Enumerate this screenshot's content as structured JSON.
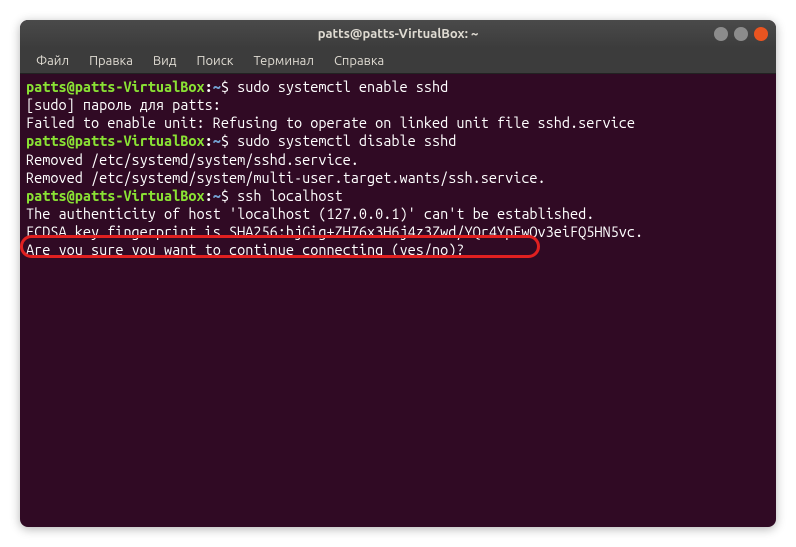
{
  "window": {
    "title": "patts@patts-VirtualBox: ~"
  },
  "menubar": {
    "items": [
      "Файл",
      "Правка",
      "Вид",
      "Поиск",
      "Терминал",
      "Справка"
    ]
  },
  "prompt": {
    "userhost": "patts@patts-VirtualBox",
    "colon": ":",
    "path": "~",
    "dollar": "$"
  },
  "lines": {
    "cmd1": " sudo systemctl enable sshd",
    "out1": "[sudo] пароль для patts:",
    "out2": "Failed to enable unit: Refusing to operate on linked unit file sshd.service",
    "cmd2": " sudo systemctl disable sshd",
    "out3": "Removed /etc/systemd/system/sshd.service.",
    "out4": "Removed /etc/systemd/system/multi-user.target.wants/ssh.service.",
    "cmd3": " ssh localhost",
    "out5": "The authenticity of host 'localhost (127.0.0.1)' can't be established.",
    "out6": "ECDSA key fingerprint is SHA256:hjGig+ZH76x3H6j4z3Zwd/YQr4YpEwQv3eiFQ5HN5vc.",
    "out7": "Are you sure you want to continue connecting (yes/no)? "
  }
}
